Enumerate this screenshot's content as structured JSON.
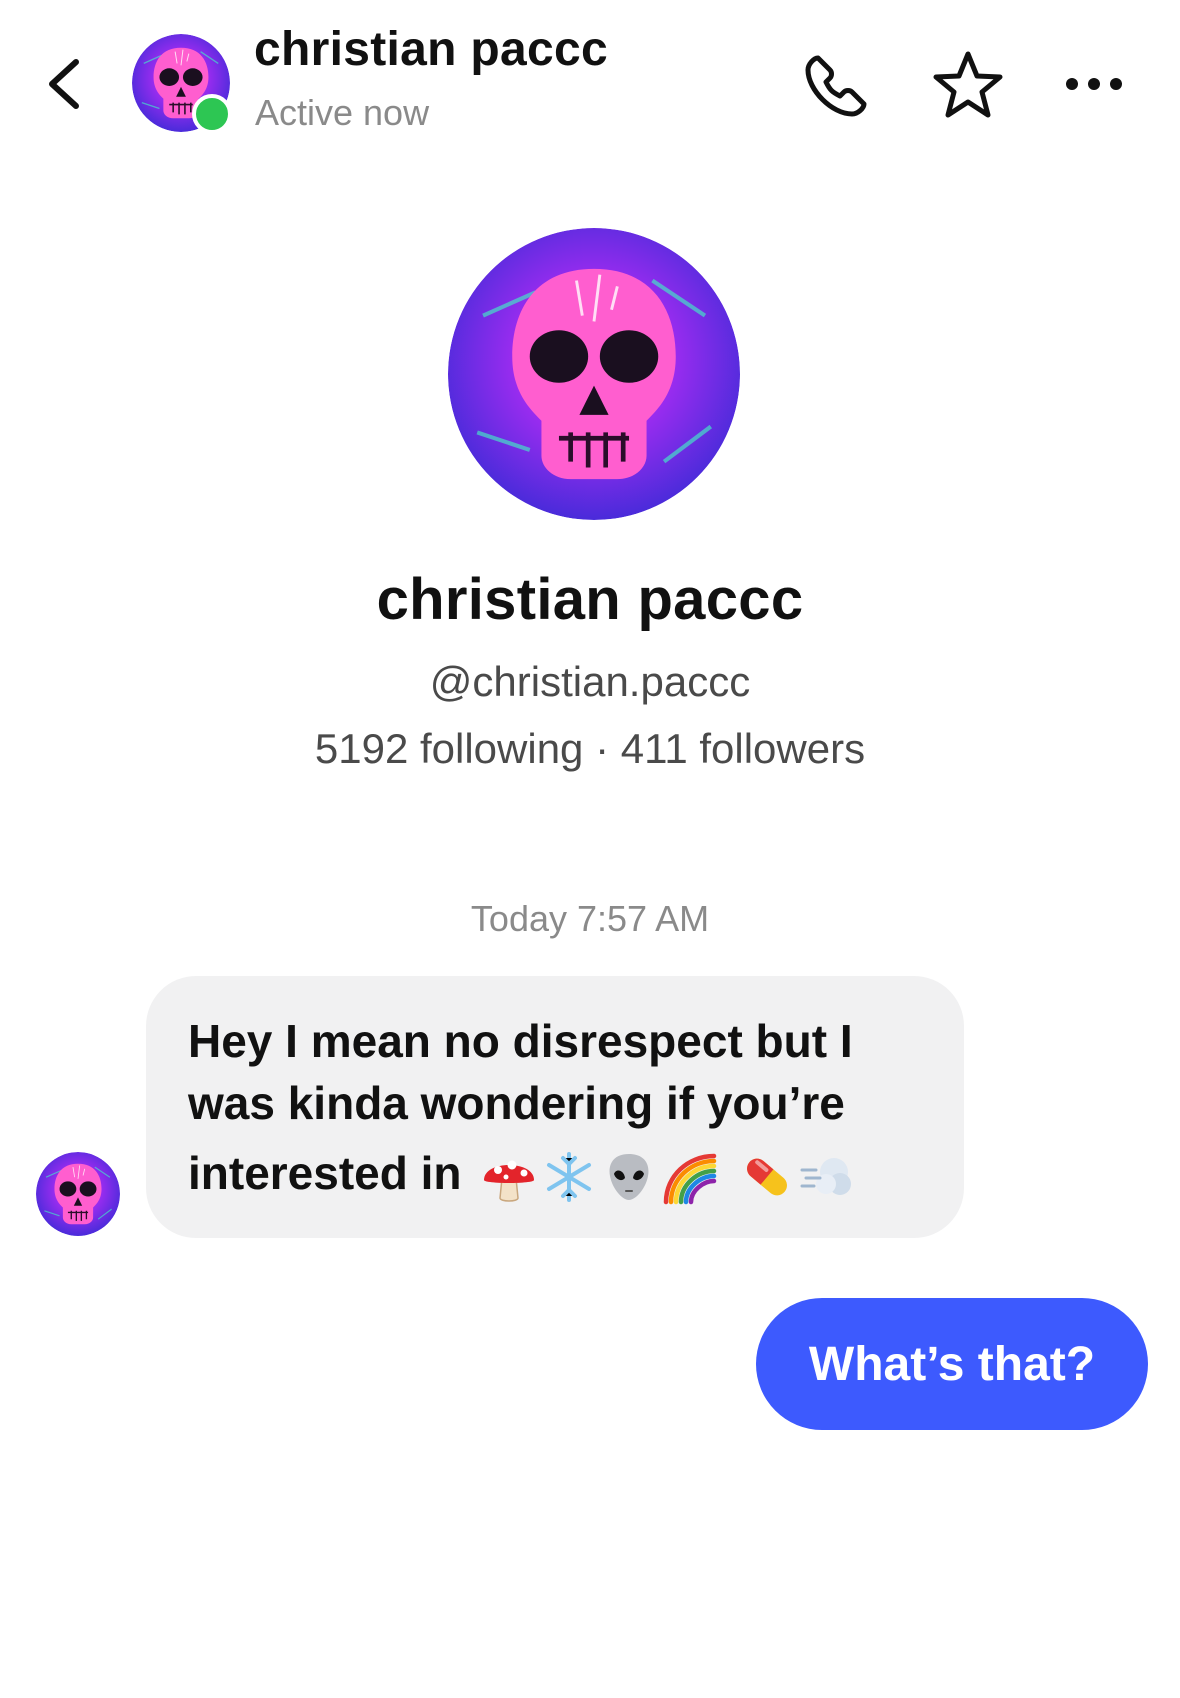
{
  "header": {
    "name": "christian paccc",
    "status": "Active now"
  },
  "profile": {
    "name": "christian paccc",
    "handle": "@christian.paccc",
    "stats": "5192 following · 411 followers"
  },
  "conversation": {
    "timestamp": "Today 7:57 AM",
    "messages": [
      {
        "direction": "incoming",
        "lines": [
          "Hey I mean no disrespect but I",
          "was kinda wondering if you’re",
          "interested in"
        ],
        "emojis": [
          "mushroom-emoji",
          "snowflake-emoji",
          "alien-emoji",
          "rainbow-emoji",
          "pill-emoji",
          "dash-emoji"
        ]
      },
      {
        "direction": "outgoing",
        "text": "What’s that?"
      }
    ]
  },
  "colors": {
    "accent": "#3d5afe",
    "online": "#2dc653",
    "incoming_bubble": "#f1f1f2",
    "muted_text": "#8a8a8a"
  },
  "icons": [
    "back-icon",
    "phone-icon",
    "star-icon",
    "more-icon"
  ]
}
